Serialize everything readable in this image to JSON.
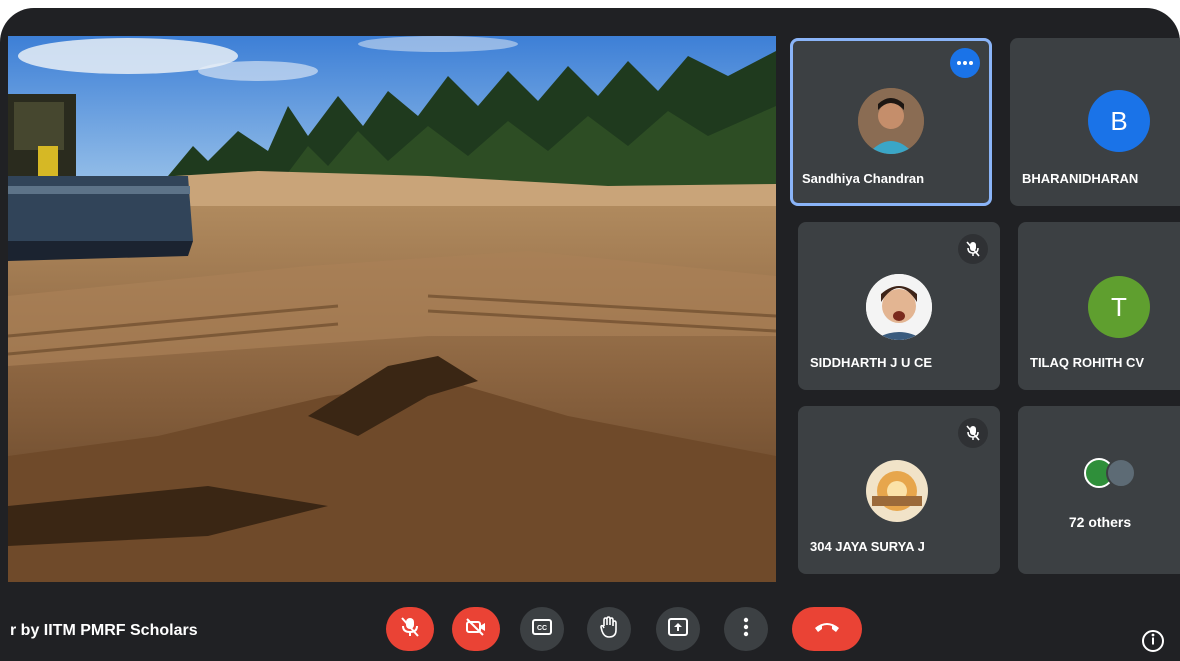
{
  "meeting": {
    "title": "r by IITM PMRF Scholars"
  },
  "participants": {
    "tiles": [
      {
        "name": "Sandhiya Chandran",
        "avatar": "photo",
        "active": true,
        "badge": "more-options-icon"
      },
      {
        "name": "BHARANIDHARAN",
        "avatar_letter": "B",
        "avatar_color": "#1a73e8"
      },
      {
        "name": "SIDDHARTH J U CE",
        "avatar": "photo",
        "badge": "mic-off-icon"
      },
      {
        "name": "TILAQ ROHITH CV",
        "avatar_letter": "T",
        "avatar_color": "#5f9f2f"
      },
      {
        "name": "304 JAYA SURYA J",
        "avatar": "photo",
        "badge": "mic-off-icon"
      }
    ],
    "others_label": "72 others"
  },
  "controls": [
    {
      "name": "mic-off-button",
      "icon": "mic-off-icon",
      "color": "#ea4335"
    },
    {
      "name": "camera-off-button",
      "icon": "camera-off-icon",
      "color": "#ea4335"
    },
    {
      "name": "captions-button",
      "icon": "captions-icon",
      "color": "#3c4043"
    },
    {
      "name": "raise-hand-button",
      "icon": "hand-icon",
      "color": "#3c4043"
    },
    {
      "name": "present-button",
      "icon": "present-icon",
      "color": "#3c4043"
    },
    {
      "name": "more-options-button",
      "icon": "more-vert-icon",
      "color": "#3c4043"
    },
    {
      "name": "leave-call-button",
      "icon": "end-call-icon",
      "color": "#ea4335"
    }
  ],
  "colors": {
    "background": "#202124",
    "tile": "#3c4043",
    "accent": "#8ab4f8",
    "danger": "#ea4335",
    "primary": "#1a73e8"
  }
}
